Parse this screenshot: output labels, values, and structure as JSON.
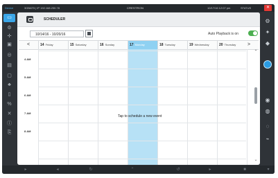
{
  "topbar": {
    "device": "Device",
    "ip_info": "3GBAT5 | IP 192.168.230.78",
    "brand": "CRESTRON",
    "time": "10/17/16  12:07 pm",
    "status": "STATUS",
    "close_glyph": "✕"
  },
  "left_nav": {
    "active_glyph": "▭",
    "icons": [
      "gear-icon",
      "fan-icon",
      "media-icon",
      "camera-icon",
      "layout-icon",
      "folder-icon",
      "usb-icon",
      "lock-icon",
      "link-icon",
      "network-icon",
      "info-icon",
      "exit-icon"
    ],
    "glyphs": [
      "⚙",
      "✢",
      "▣",
      "◎",
      "▤",
      "▢",
      "♣",
      "▯",
      "%",
      "✕",
      "ⓘ",
      "⎘"
    ]
  },
  "right_nav": {
    "icons": [
      "settings-icon",
      "home-icon",
      "shield-icon",
      "dial-icon",
      "sync-icon",
      "ring-icon",
      "tag-icon"
    ],
    "glyphs": [
      "⚙",
      "✦",
      "◆",
      "◉",
      "◍",
      "◌",
      "⌁"
    ]
  },
  "bottom_nav": {
    "icons": [
      "back-end-icon",
      "rewind-icon",
      "refresh-icon",
      "up-icon",
      "clock-icon",
      "forward-icon",
      "square-icon",
      "menu-icon"
    ],
    "glyphs": [
      "▸",
      "◂",
      "↻",
      "⌃",
      "↺",
      "▸",
      "■",
      "▾"
    ]
  },
  "scheduler": {
    "title": "SCHEDULER",
    "date_range": "10/14/16 - 10/20/16",
    "auto_playback_label": "Auto Playback is on",
    "auto_playback_on": true,
    "nav_prev": "<",
    "nav_next": ">",
    "days": [
      {
        "num": "14",
        "name": "Friday",
        "today": false
      },
      {
        "num": "15",
        "name": "Saturday",
        "today": false
      },
      {
        "num": "16",
        "name": "Sunday",
        "today": false
      },
      {
        "num": "17",
        "name": "Monday",
        "today": true
      },
      {
        "num": "18",
        "name": "Tuesday",
        "today": false
      },
      {
        "num": "19",
        "name": "Wednesday",
        "today": false
      },
      {
        "num": "20",
        "name": "Thursday",
        "today": false
      }
    ],
    "hours": [
      "4 AM",
      "5 AM",
      "6 AM",
      "7 AM",
      "8 AM"
    ],
    "empty_message": "Tap to schedule a new event",
    "scroll_up": "⌃",
    "scroll_down": "⌄"
  },
  "colors": {
    "accent": "#3ba6e8",
    "today_column": "#b7e1f6",
    "toggle_on": "#4caf50",
    "close": "#e53935"
  }
}
